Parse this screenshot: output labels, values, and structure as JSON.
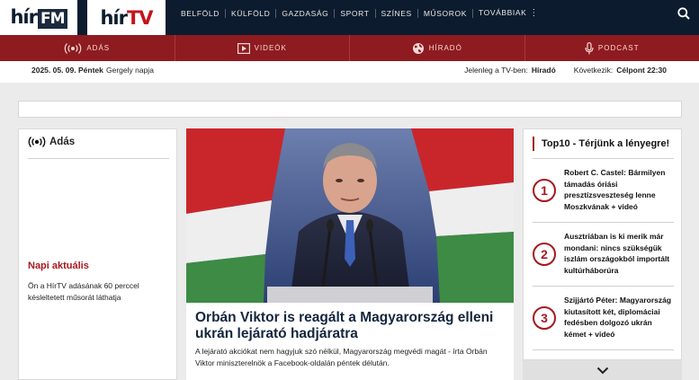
{
  "header": {
    "logo_fm": {
      "main": "hír",
      "box": "FM"
    },
    "logo_tv": {
      "main": "hír",
      "accent": "TV"
    },
    "nav": [
      "BELFÖLD",
      "KÜLFÖLD",
      "GAZDASÁG",
      "SPORT",
      "SZÍNES",
      "MŰSOROK",
      "TOVÁBBIAK"
    ],
    "colors": {
      "topbar": "#0c1c2e",
      "redbar": "#8e1b1f",
      "accent": "#a8171e"
    }
  },
  "redbar": {
    "items": [
      {
        "label": "ADÁS",
        "icon": "broadcast-icon"
      },
      {
        "label": "VIDEÓK",
        "icon": "play-icon"
      },
      {
        "label": "HÍRADÓ",
        "icon": "globe-icon"
      },
      {
        "label": "PODCAST",
        "icon": "microphone-icon"
      }
    ]
  },
  "infobar": {
    "date": "2025. 05. 09. Péntek",
    "nameday": "Gergely napja",
    "now_label": "Jelenleg a TV-ben:",
    "now_value": "Híradó",
    "next_label": "Következik:",
    "next_value": "Célpont 22:30"
  },
  "left": {
    "title": "Adás",
    "napi_title": "Napi aktuális",
    "napi_text": "Ön a HírTV adásának 60 perccel késleltetett műsorát láthatja"
  },
  "article": {
    "headline": "Orbán Viktor is reagált a Magyarország elleni ukrán lejárató hadjáratra",
    "lead": "A lejárató akciókat nem hagyjuk szó nélkül, Magyarország megvédi magát - írta Orbán Viktor miniszterelnök a Facebook-oldalán péntek délután."
  },
  "top10": {
    "title": "Top10 - Térjünk a lényegre!",
    "items": [
      {
        "rank": "1",
        "text": "Robert C. Castel: Bármilyen támadás óriási presztízsveszteség lenne Moszkvának + videó"
      },
      {
        "rank": "2",
        "text": "Ausztriában is ki merik már mondani: nincs szükségük iszlám országokból importált kultúrháborúra"
      },
      {
        "rank": "3",
        "text": "Szijjártó Péter: Magyarország kiutasított két, diplomáciai fedésben dolgozó ukrán kémet + videó"
      }
    ]
  }
}
